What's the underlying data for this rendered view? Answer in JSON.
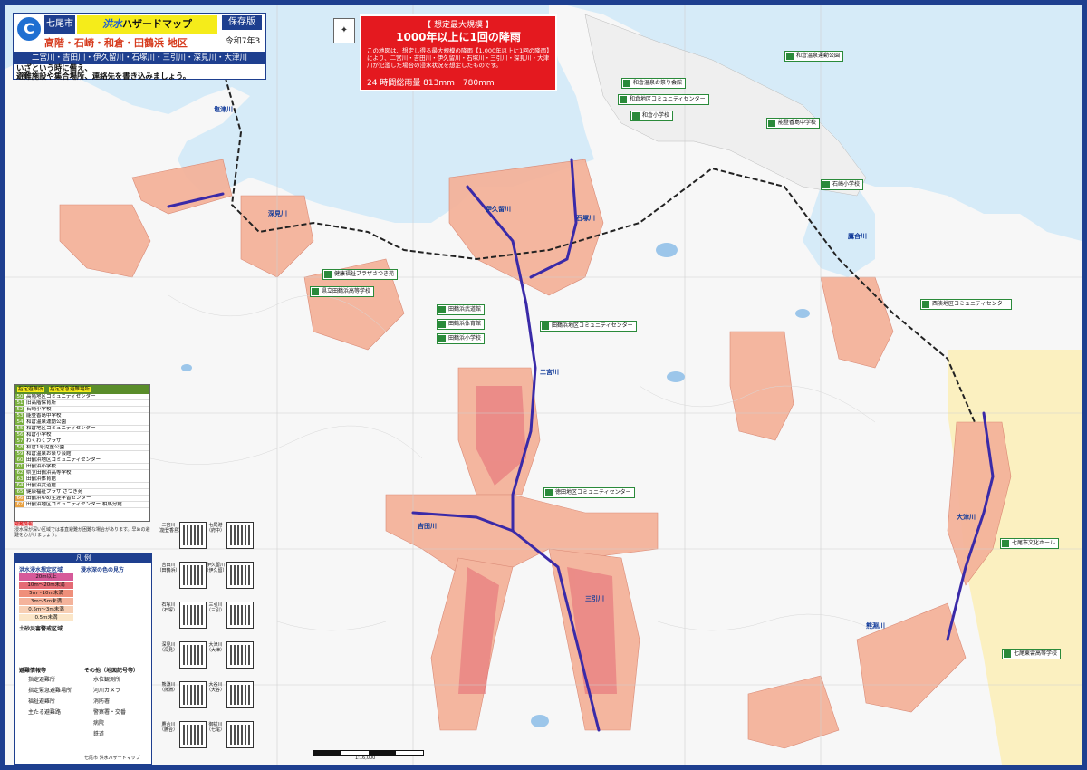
{
  "header": {
    "city": "七尾市",
    "title_a": "洪水",
    "title_b": "ハザードマップ",
    "edition": "保存版",
    "area": "高階・石崎・和倉・田鶴浜 地区",
    "date": "令和7年3月",
    "rivers": "二宮川・吉田川・伊久留川・石塚川・三引川・深見川・大津川",
    "note_1": "いざという時に備え、",
    "note_2": "避難施設や集合場所、連絡先を書き込みましょう。"
  },
  "scenario": {
    "tag": "【 想定最大規模 】",
    "headline": "1000年以上に1回の降雨",
    "text": "この地図は、想定し得る最大規模の降雨【1,000年以上に1回の降雨】により、二宮川・吉田川・伊久留川・石塚川・三引川・深見川・大津川が氾濫した場合の浸水状況を想定したものです。",
    "rain": "24 時間総雨量 813mm",
    "rain_alt": "780mm"
  },
  "shelter_table": {
    "header_a": "指定避難所",
    "header_b": "指定緊急避難場所",
    "rows": [
      {
        "no": "50",
        "name": "高階地区コミュニティセンター"
      },
      {
        "no": "51",
        "name": "旧高階保育所"
      },
      {
        "no": "52",
        "name": "石崎小学校"
      },
      {
        "no": "53",
        "name": "能登香島中学校"
      },
      {
        "no": "54",
        "name": "和倉温泉運動公園"
      },
      {
        "no": "55",
        "name": "和倉地区コミュニティセンター"
      },
      {
        "no": "56",
        "name": "和倉小学校"
      },
      {
        "no": "57",
        "name": "わくわくプラザ"
      },
      {
        "no": "58",
        "name": "和倉1号児童公園"
      },
      {
        "no": "59",
        "name": "和倉温泉お祭り会館"
      },
      {
        "no": "60",
        "name": "田鶴浜地区コミュニティセンター"
      },
      {
        "no": "61",
        "name": "田鶴浜小学校"
      },
      {
        "no": "62",
        "name": "県立田鶴浜高等学校"
      },
      {
        "no": "63",
        "name": "田鶴浜体育館"
      },
      {
        "no": "64",
        "name": "田鶴浜武道館"
      },
      {
        "no": "65",
        "name": "健康福祉プラザ さつき苑"
      },
      {
        "no": "66",
        "name": "田鶴浜ゆめ生涯学習センター"
      },
      {
        "no": "67",
        "name": "田鶴浜地区コミュニティセンター 相馬分館"
      }
    ]
  },
  "alert": {
    "title": "避難情報",
    "text": "浸水深が深い区域では垂直避難が困難な場合があります。早めの避難を心がけましょう。"
  },
  "legend": {
    "title": "凡 例",
    "depth_title": "洪水浸水想定区域",
    "depth_title_b": "浸水深の色の見方",
    "depths": [
      {
        "label": "20m以上",
        "color": "#d65a9a"
      },
      {
        "label": "10m〜20m未満",
        "color": "#e46a74"
      },
      {
        "label": "5m〜10m未満",
        "color": "#ef8f7a"
      },
      {
        "label": "3m〜5m未満",
        "color": "#f4b39b"
      },
      {
        "label": "0.5m〜3m未満",
        "color": "#f7cfb4"
      },
      {
        "label": "0.5m未満",
        "color": "#fbe6c8"
      }
    ],
    "landslide": "土砂災害警戒区域",
    "evac": "避難情報等",
    "items": [
      "指定避難所",
      "指定緊急避難場所",
      "福祉避難所",
      "主たる避難路"
    ],
    "other": "その他（地図記号等）",
    "others": [
      "水位観測所",
      "河川カメラ",
      "消防署",
      "警察署・交番",
      "病院",
      "鉄道"
    ],
    "footer": "七尾市 洪水ハザードマップ"
  },
  "qr": [
    {
      "river": "二宮川",
      "place": "（能登香島）"
    },
    {
      "river": "七尾港",
      "place": "（府中）"
    },
    {
      "river": "吉田川",
      "place": "（田鶴浜）"
    },
    {
      "river": "伊久留川",
      "place": "（伊久留）"
    },
    {
      "river": "石塚川",
      "place": "（石塚）"
    },
    {
      "river": "三引川",
      "place": "（三引）"
    },
    {
      "river": "深見川",
      "place": "（深見）"
    },
    {
      "river": "大津川",
      "place": "（大津）"
    },
    {
      "river": "熊淵川",
      "place": "（熊淵）"
    },
    {
      "river": "大谷川",
      "place": "（大谷）"
    },
    {
      "river": "鷹合川",
      "place": "（鷹合）"
    },
    {
      "river": "御祓川",
      "place": "（七尾）"
    }
  ],
  "map": {
    "rivers": [
      "塩津川",
      "深見川",
      "吉田川",
      "二宮川",
      "伊久留川",
      "石塚川",
      "三引川",
      "大津川",
      "熊淵川",
      "鷹合川"
    ],
    "shelters": [
      {
        "name": "和倉温泉お祭り会館"
      },
      {
        "name": "和倉地区コミュニティセンター"
      },
      {
        "name": "和倉小学校"
      },
      {
        "name": "能登香島中学校"
      },
      {
        "name": "和倉温泉運動公園"
      },
      {
        "name": "石崎小学校"
      },
      {
        "name": "健康福祉プラザさつき苑"
      },
      {
        "name": "県立田鶴浜高等学校"
      },
      {
        "name": "田鶴浜武道館"
      },
      {
        "name": "田鶴浜体育館"
      },
      {
        "name": "田鶴浜小学校"
      },
      {
        "name": "田鶴浜地区コミュニティセンター"
      },
      {
        "name": "徳田地区コミュニティセンター"
      },
      {
        "name": "西湊地区コミュニティセンター"
      },
      {
        "name": "七尾市文化ホール"
      },
      {
        "name": "七尾東雲高等学校"
      }
    ],
    "scale": "1:16,000"
  },
  "colors": {
    "frame": "#1e3f8f",
    "sea": "#d6ebf8",
    "land": "#f7f7f7",
    "flood": "#f4b39b",
    "river": "#3a2aa8"
  }
}
